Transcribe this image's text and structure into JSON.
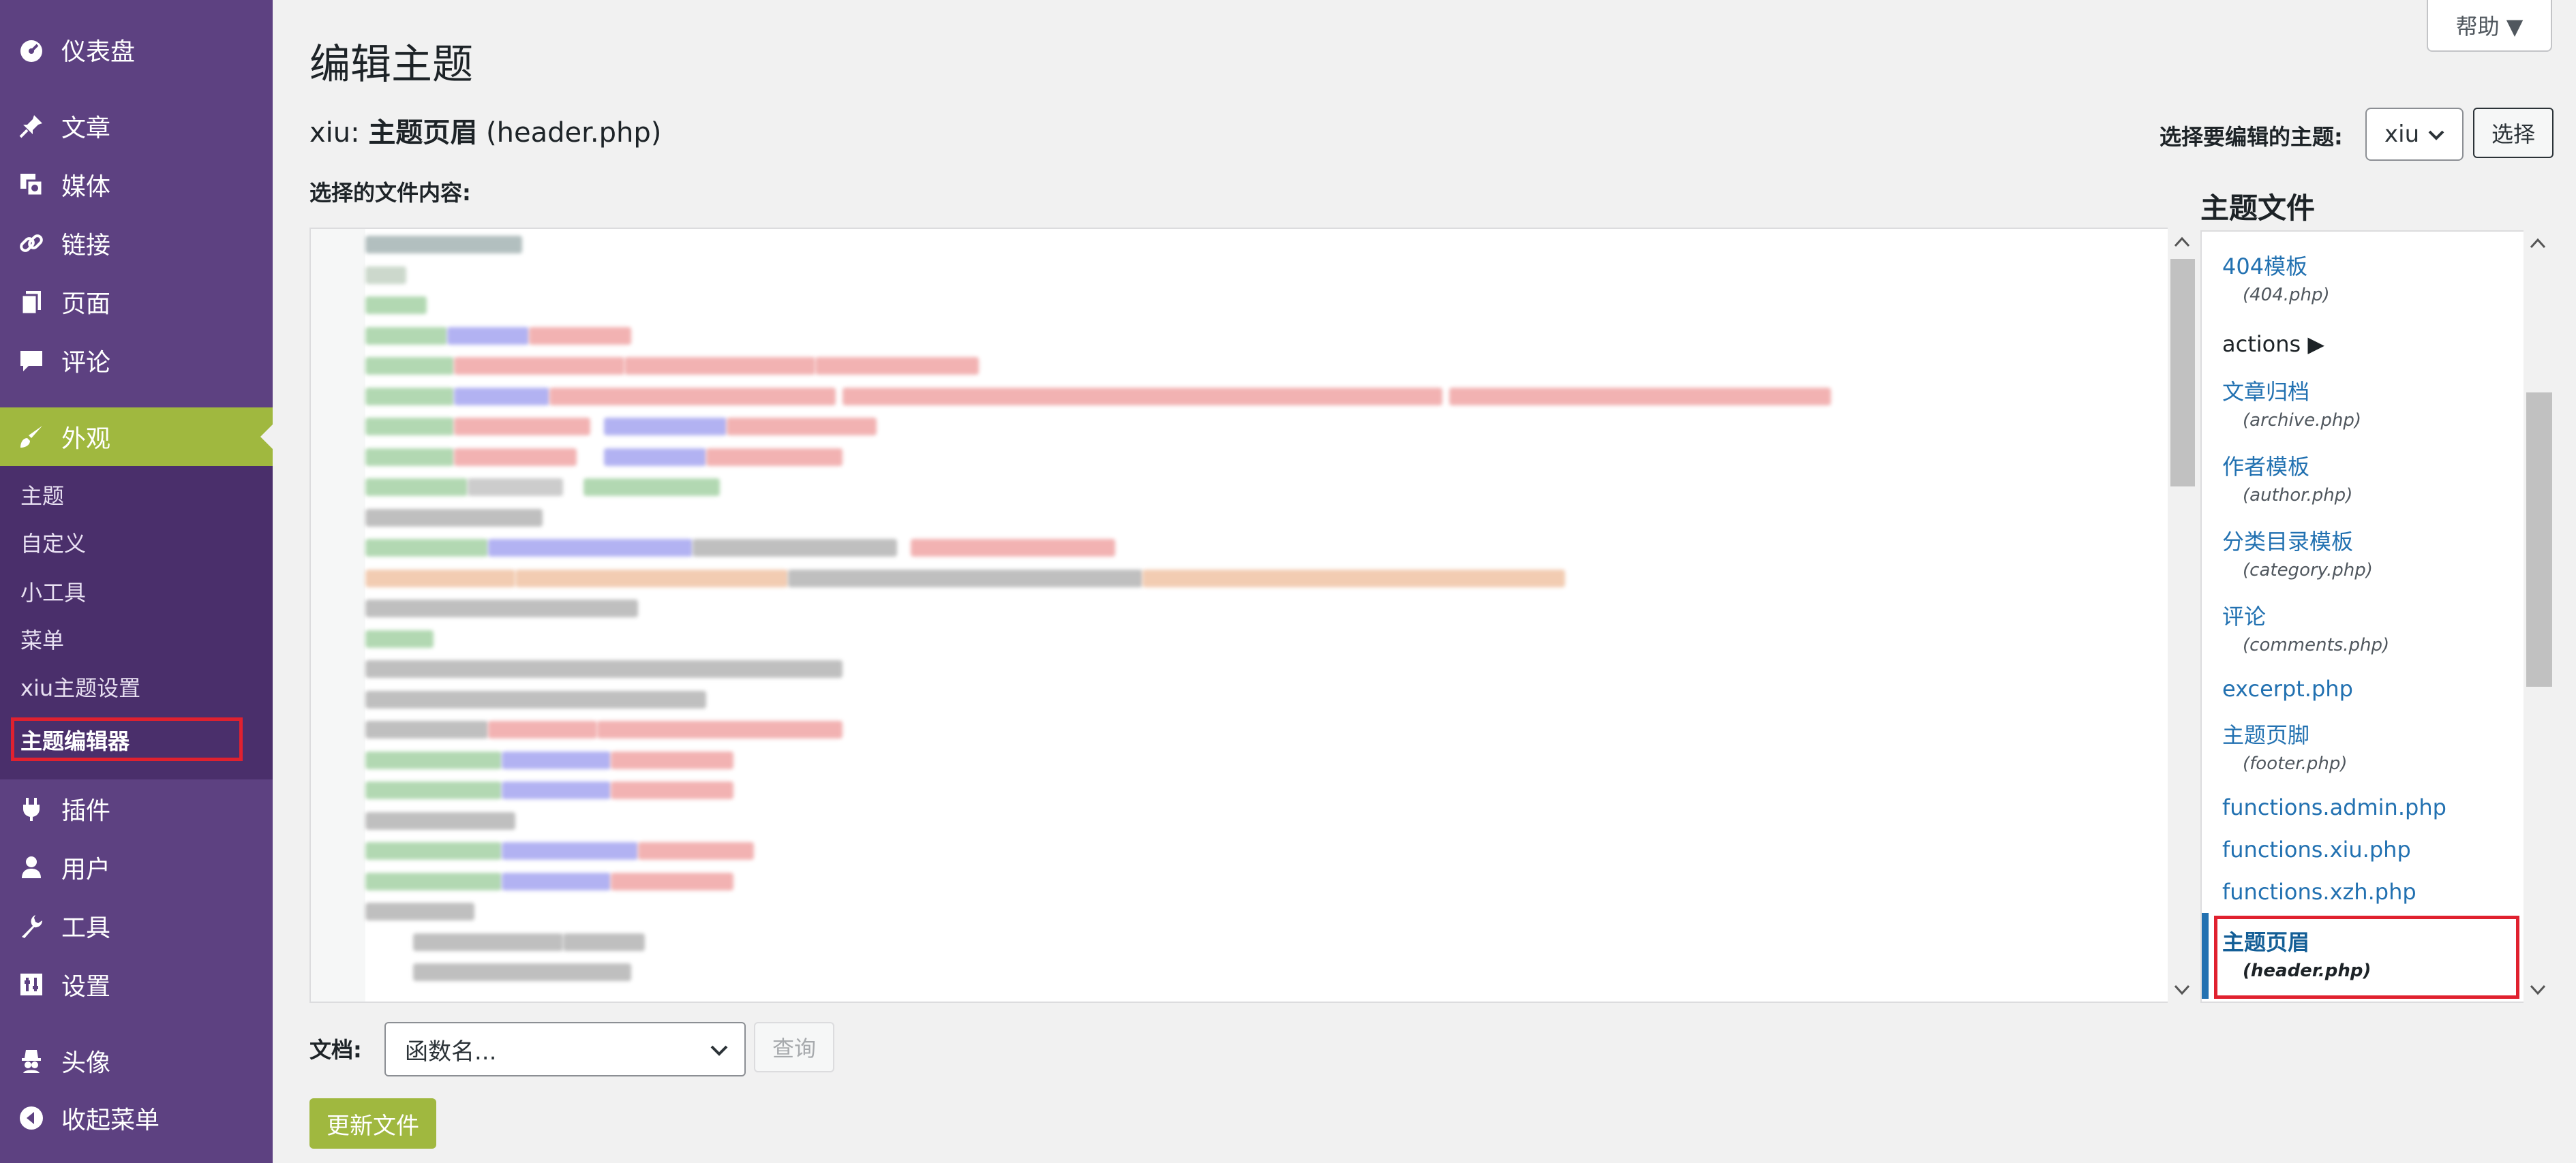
{
  "sidebar": {
    "dashboard": {
      "label": "仪表盘",
      "icon": "dashboard-icon"
    },
    "posts": {
      "label": "文章",
      "icon": "pin-icon"
    },
    "media": {
      "label": "媒体",
      "icon": "media-icon"
    },
    "links": {
      "label": "链接",
      "icon": "link-icon"
    },
    "pages": {
      "label": "页面",
      "icon": "page-icon"
    },
    "comments": {
      "label": "评论",
      "icon": "comment-icon"
    },
    "appearance": {
      "label": "外观",
      "icon": "brush-icon"
    },
    "submenu": [
      "主题",
      "自定义",
      "小工具",
      "菜单",
      "xiu主题设置",
      "主题编辑器"
    ],
    "plugins": {
      "label": "插件",
      "icon": "plugin-icon"
    },
    "users": {
      "label": "用户",
      "icon": "user-icon"
    },
    "tools": {
      "label": "工具",
      "icon": "wrench-icon"
    },
    "settings": {
      "label": "设置",
      "icon": "settings-icon"
    },
    "avatar": {
      "label": "头像",
      "icon": "avatar-icon"
    },
    "collapse": {
      "label": "收起菜单",
      "icon": "collapse-icon"
    }
  },
  "header": {
    "help": "帮助 ▼",
    "title": "编辑主题",
    "file_prefix": "xiu: ",
    "file_name": "主题页眉",
    "file_suffix": " (header.php)",
    "content_label": "选择的文件内容:",
    "select_theme_label": "选择要编辑的主题:",
    "theme_value": "xiu",
    "select_button": "选择"
  },
  "theme_files": {
    "title": "主题文件",
    "entries": [
      {
        "name": "404模板",
        "file": "(404.php)"
      },
      {
        "name": "actions ▶"
      },
      {
        "name": "文章归档",
        "file": "(archive.php)"
      },
      {
        "name": "作者模板",
        "file": "(author.php)"
      },
      {
        "name": "分类目录模板",
        "file": "(category.php)"
      },
      {
        "name": "评论",
        "file": "(comments.php)"
      },
      {
        "name": "excerpt.php"
      },
      {
        "name": "主题页脚",
        "file": "(footer.php)"
      },
      {
        "name": "functions.admin.php"
      },
      {
        "name": "functions.xiu.php"
      },
      {
        "name": "functions.xzh.php"
      },
      {
        "name": "主题页眉",
        "file": "(header.php)"
      }
    ]
  },
  "docs": {
    "label": "文档:",
    "placeholder": "函数名...",
    "lookup": "查询"
  },
  "update_button": "更新文件",
  "colors": {
    "sidebar": "#5d4181",
    "accent": "#a0b83f",
    "link": "#2271b1",
    "highlight": "#e0212f"
  }
}
